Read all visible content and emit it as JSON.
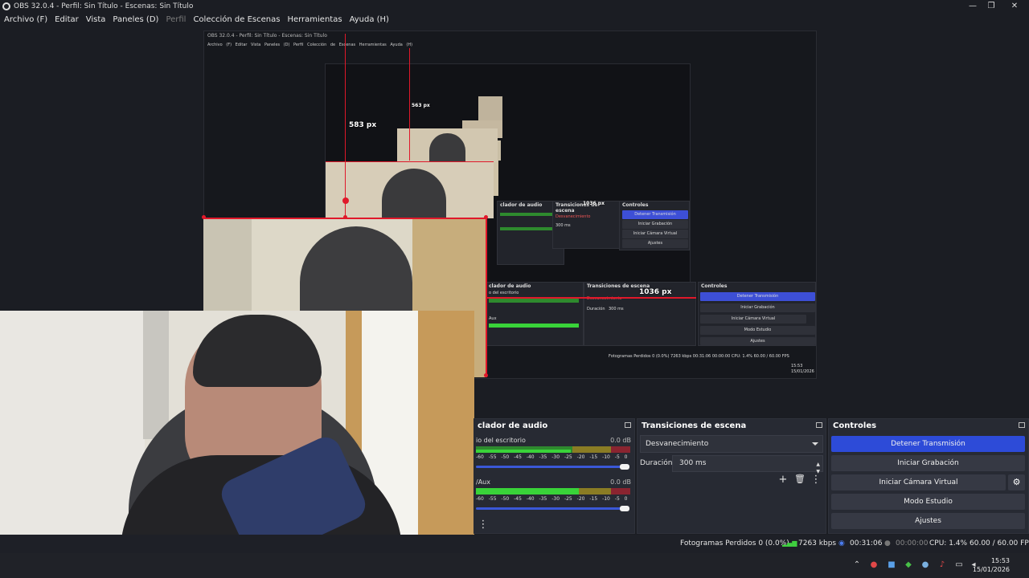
{
  "window": {
    "title": "OBS 32.0.4 - Perfil: Sin Título - Escenas: Sin Título",
    "minimize": "—",
    "maximize": "❐",
    "close": "✕"
  },
  "menu": [
    {
      "label": "Archivo (F)",
      "enabled": true
    },
    {
      "label": "Editar",
      "enabled": true
    },
    {
      "label": "Vista",
      "enabled": true
    },
    {
      "label": "Paneles (D)",
      "enabled": true
    },
    {
      "label": "Perfil",
      "enabled": false
    },
    {
      "label": "Colección de Escenas",
      "enabled": true
    },
    {
      "label": "Herramientas",
      "enabled": true
    },
    {
      "label": "Ayuda (H)",
      "enabled": true
    }
  ],
  "preview": {
    "nested_title": "OBS 32.0.4 - Perfil: Sin Título - Escenas: Sin Título",
    "nested_menu": "Archivo (F)  Editar  Vista  Paneles (D)  Perfil  Colección de Escenas  Herramientas  Ayuda (H)",
    "dim_583": "583 px",
    "dim_563": "563 px",
    "dim_1036": "1036 px",
    "dim_1036_small": "1036 px",
    "nested_mixer": "clador de audio",
    "nested_desktop": "o del escritorio",
    "nested_aux": "Aux",
    "nested_transitions": "Transiciones de escena",
    "nested_fade": "Desvanecimiento",
    "nested_duration_label": "Duración",
    "nested_duration": "300 ms",
    "nested_controls": "Controles",
    "nested_stop": "Detener Transmisión",
    "nested_record": "Iniciar Grabación",
    "nested_vcam": "Iniciar Cámara Virtual",
    "nested_studio": "Modo Estudio",
    "nested_settings": "Ajustes",
    "nested_status": "Fotogramas Perdidos 0 (0.0%)   7263 kbps   00:31:06   00:00:00   CPU: 1.4%   60.00 / 60.00 FPS",
    "nested_time": "15:53",
    "nested_date": "15/01/2026"
  },
  "audio_mixer": {
    "title": "clador de audio",
    "channels": [
      {
        "name": "io del escritorio",
        "db": "0.0 dB",
        "level": 0.72
      },
      {
        "name": "/Aux",
        "db": "0.0 dB",
        "level": 0.72
      }
    ],
    "ticks": "-60 -55 -50 -45 -40 -35 -30 -25 -20 -15 -10 -5 0"
  },
  "transitions": {
    "title": "Transiciones de escena",
    "selected": "Desvanecimiento",
    "duration_label": "Duración",
    "duration_value": "300 ms"
  },
  "controls": {
    "title": "Controles",
    "stop_streaming": "Detener Transmisión",
    "start_recording": "Iniciar Grabación",
    "start_virtual_cam": "Iniciar Cámara Virtual",
    "studio_mode": "Modo Estudio",
    "settings": "Ajustes"
  },
  "status": {
    "dropped_frames": "Fotogramas Perdidos 0 (0.0%)",
    "bitrate": "7263 kbps",
    "stream_time": "00:31:06",
    "record_time": "00:00:00",
    "cpu": "CPU: 1.4%",
    "fps": "60.00 / 60.00 FPS"
  },
  "taskbar": {
    "time": "15:53",
    "date": "15/01/2026"
  },
  "colors": {
    "accent_blue": "#2d4bd8",
    "guide_red": "#e0182a",
    "meter_green": "#39d339"
  }
}
